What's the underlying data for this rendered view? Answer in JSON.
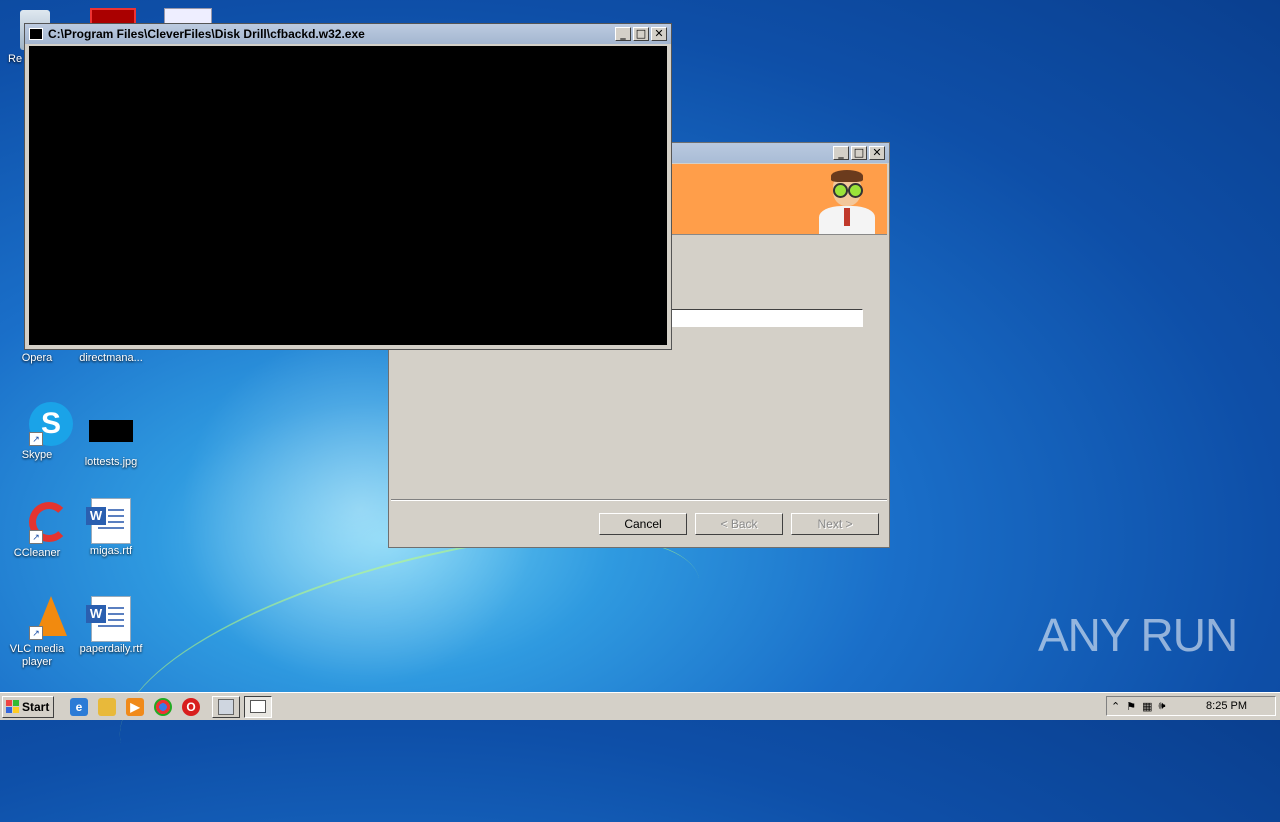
{
  "desktop": {
    "icons": [
      {
        "label": "Re"
      },
      {
        "label": "Opera"
      },
      {
        "label": "directmana..."
      },
      {
        "label": "Skype"
      },
      {
        "label": "lottests.jpg"
      },
      {
        "label": "CCleaner"
      },
      {
        "label": "migas.rtf"
      },
      {
        "label": "VLC media player"
      },
      {
        "label": "paperdaily.rtf"
      }
    ],
    "watermark": "ANY RUN"
  },
  "console_window": {
    "title": "C:\\Program Files\\CleverFiles\\Disk Drill\\cfbackd.w32.exe",
    "buttons": {
      "minimize": "_",
      "maximize": "□",
      "close": "✕"
    }
  },
  "installer_window": {
    "title": "",
    "progress": 0.26,
    "buttons": {
      "cancel": "Cancel",
      "back": "< Back",
      "next": "Next >"
    }
  },
  "taskbar": {
    "start_label": "Start",
    "quick_launch": [
      "ie-icon",
      "explorer-icon",
      "media-icon",
      "chrome-icon",
      "opera-icon"
    ],
    "clock": "8:25 PM"
  },
  "colors": {
    "banner": "#ff9e4a",
    "progress_fill": "#0b2a6d",
    "console_bg": "#000000"
  }
}
